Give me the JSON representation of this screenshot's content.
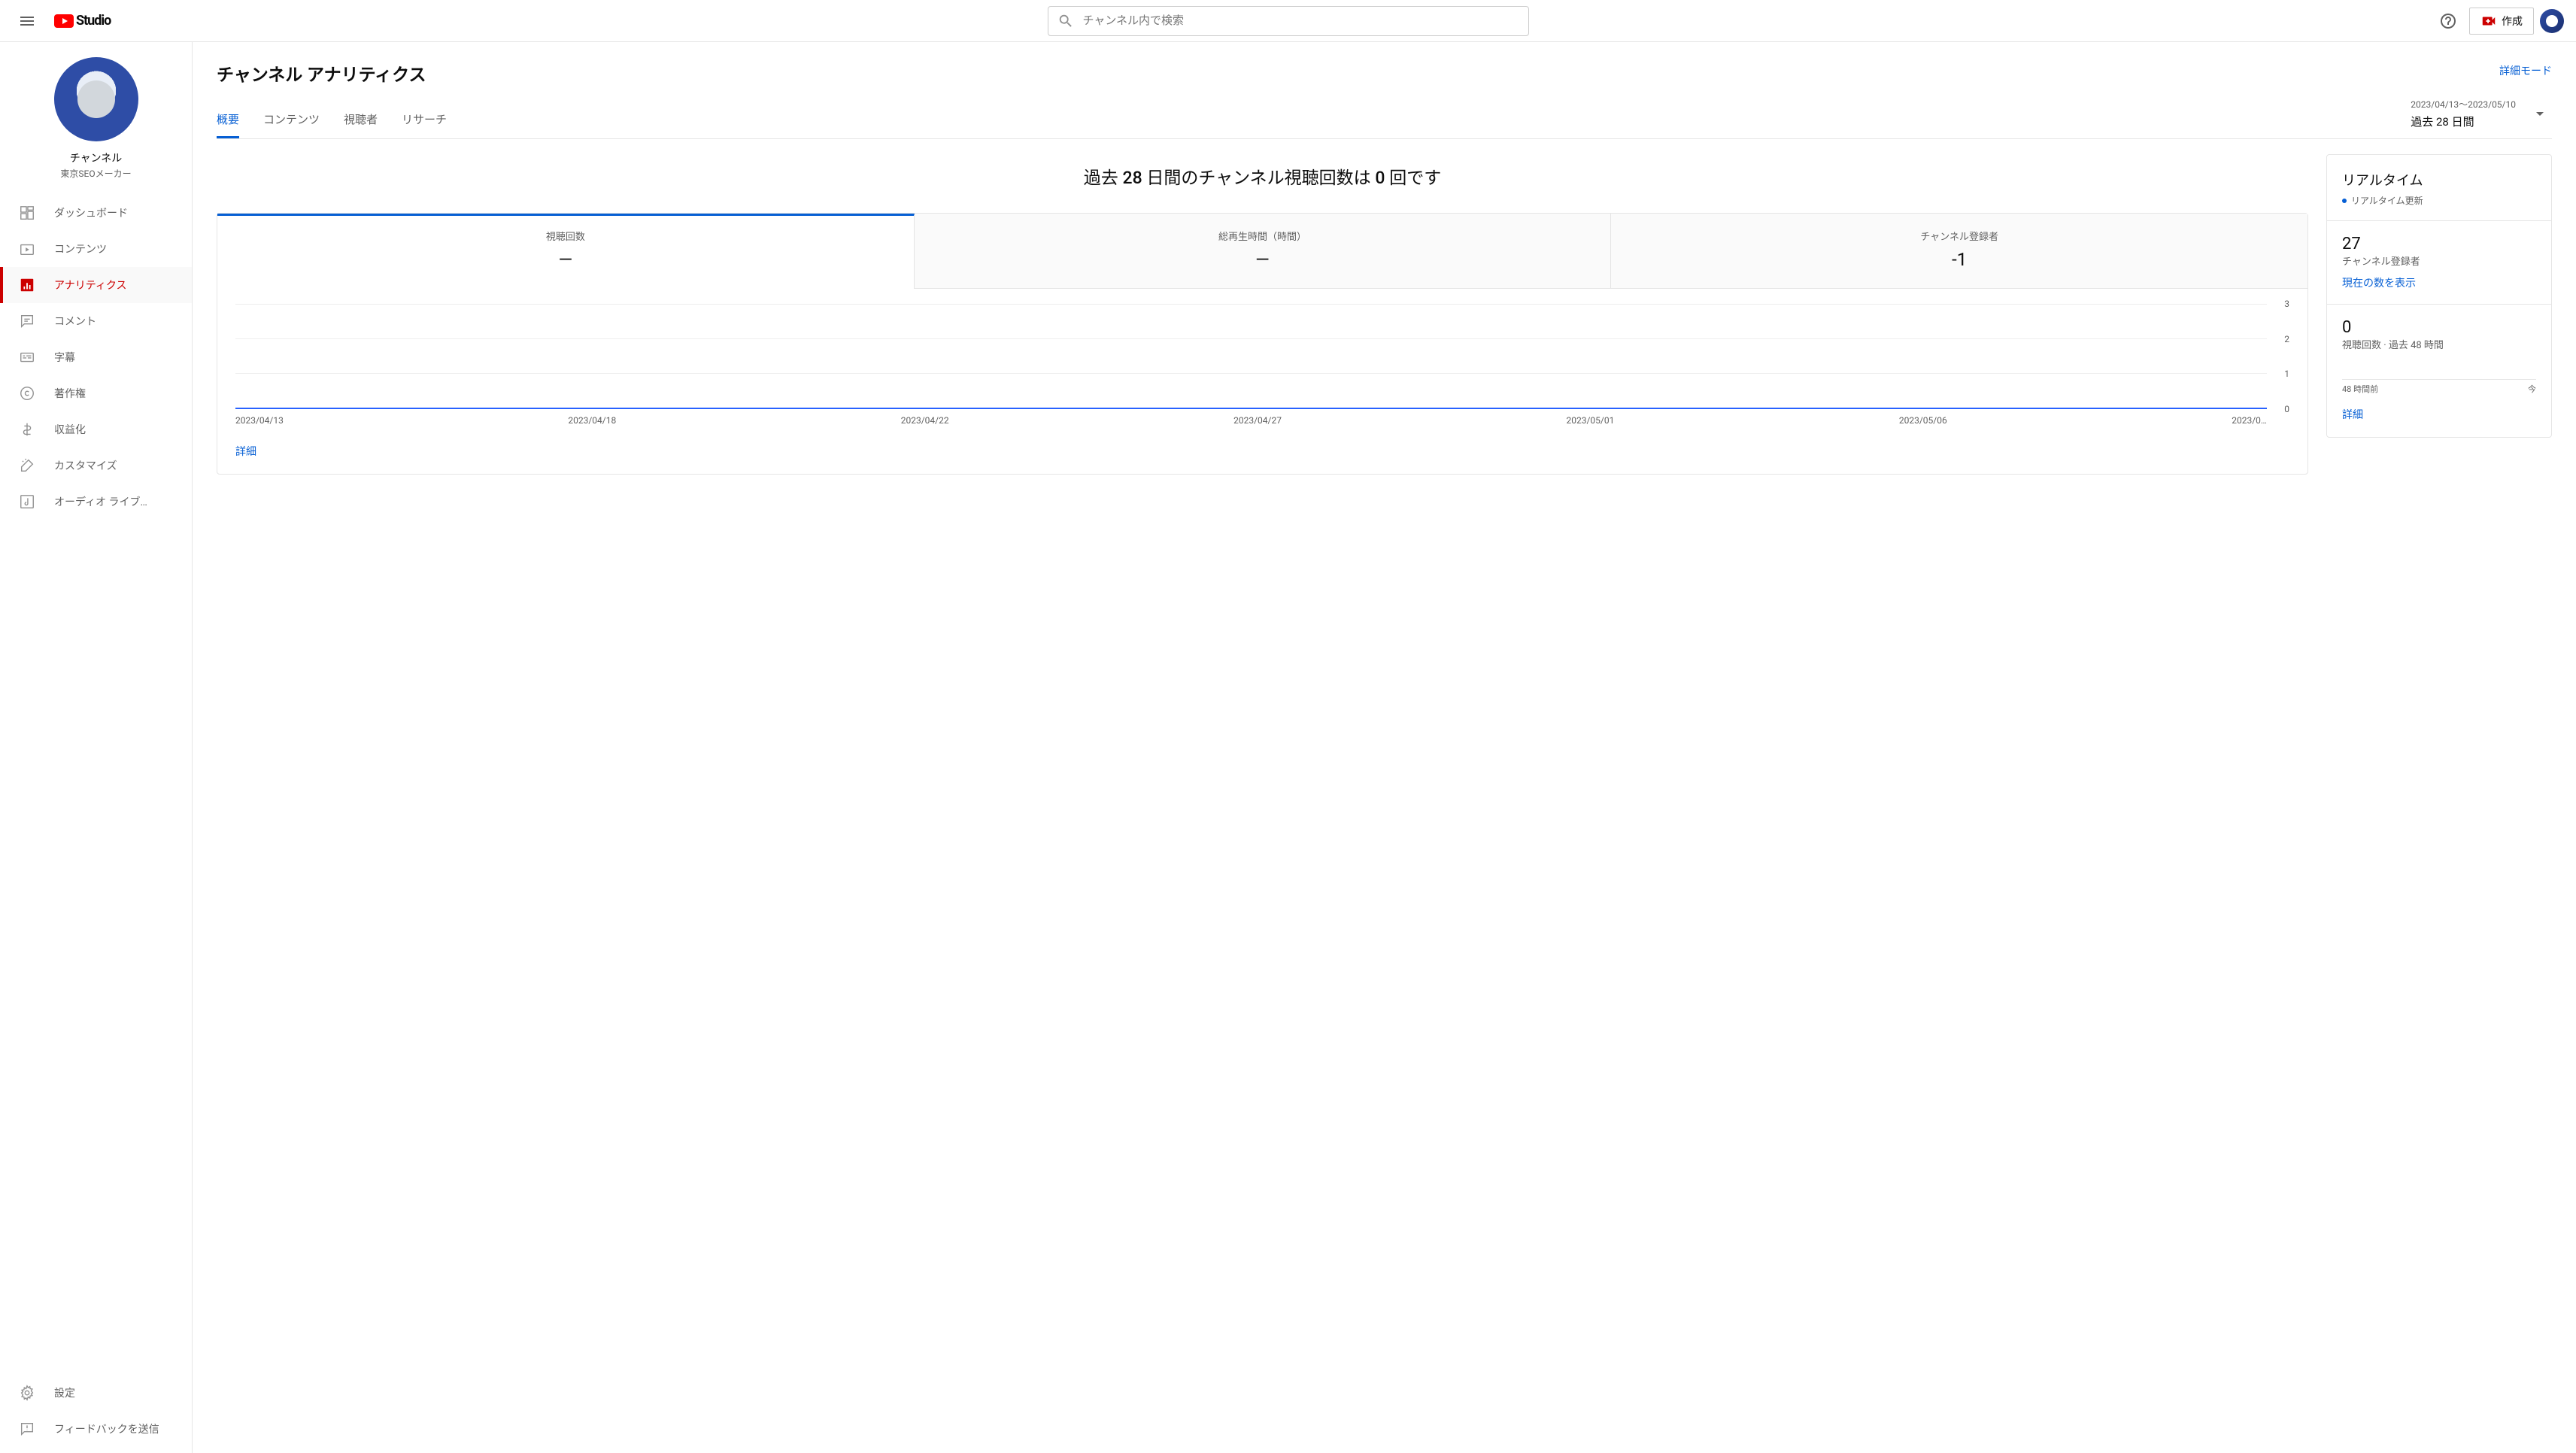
{
  "header": {
    "logo_text": "Studio",
    "search_placeholder": "チャンネル内で検索",
    "create_label": "作成"
  },
  "sidebar": {
    "channel_label": "チャンネル",
    "channel_name": "東京SEOメーカー",
    "nav": [
      {
        "label": "ダッシュボード"
      },
      {
        "label": "コンテンツ"
      },
      {
        "label": "アナリティクス"
      },
      {
        "label": "コメント"
      },
      {
        "label": "字幕"
      },
      {
        "label": "著作権"
      },
      {
        "label": "収益化"
      },
      {
        "label": "カスタマイズ"
      },
      {
        "label": "オーディオ ライブ…"
      }
    ],
    "bottom": [
      {
        "label": "設定"
      },
      {
        "label": "フィードバックを送信"
      }
    ]
  },
  "page": {
    "title": "チャンネル アナリティクス",
    "advanced_mode": "詳細モード",
    "tabs": [
      "概要",
      "コンテンツ",
      "視聴者",
      "リサーチ"
    ],
    "date_range": "2023/04/13～2023/05/10",
    "date_label": "過去 28 日間",
    "headline": "過去 28 日間のチャンネル視聴回数は 0 回です"
  },
  "metrics": [
    {
      "label": "視聴回数",
      "value": "—"
    },
    {
      "label": "総再生時間（時間）",
      "value": "—"
    },
    {
      "label": "チャンネル登録者",
      "value": "-1"
    }
  ],
  "chart_data": {
    "type": "line",
    "x": [
      "2023/04/13",
      "2023/04/18",
      "2023/04/22",
      "2023/04/27",
      "2023/05/01",
      "2023/05/06",
      "2023/0…"
    ],
    "y_ticks": [
      0,
      1,
      2,
      3
    ],
    "series": [
      {
        "name": "視聴回数",
        "values": [
          0,
          0,
          0,
          0,
          0,
          0,
          0
        ]
      }
    ],
    "ylim": [
      0,
      3
    ]
  },
  "chart_footer_link": "詳細",
  "realtime": {
    "title": "リアルタイム",
    "live_label": "リアルタイム更新",
    "subs_count": "27",
    "subs_label": "チャンネル登録者",
    "subs_link": "現在の数を表示",
    "views_count": "0",
    "views_label": "視聴回数 · 過去 48 時間",
    "bar_start": "48 時間前",
    "bar_end": "今",
    "detail_link": "詳細"
  }
}
